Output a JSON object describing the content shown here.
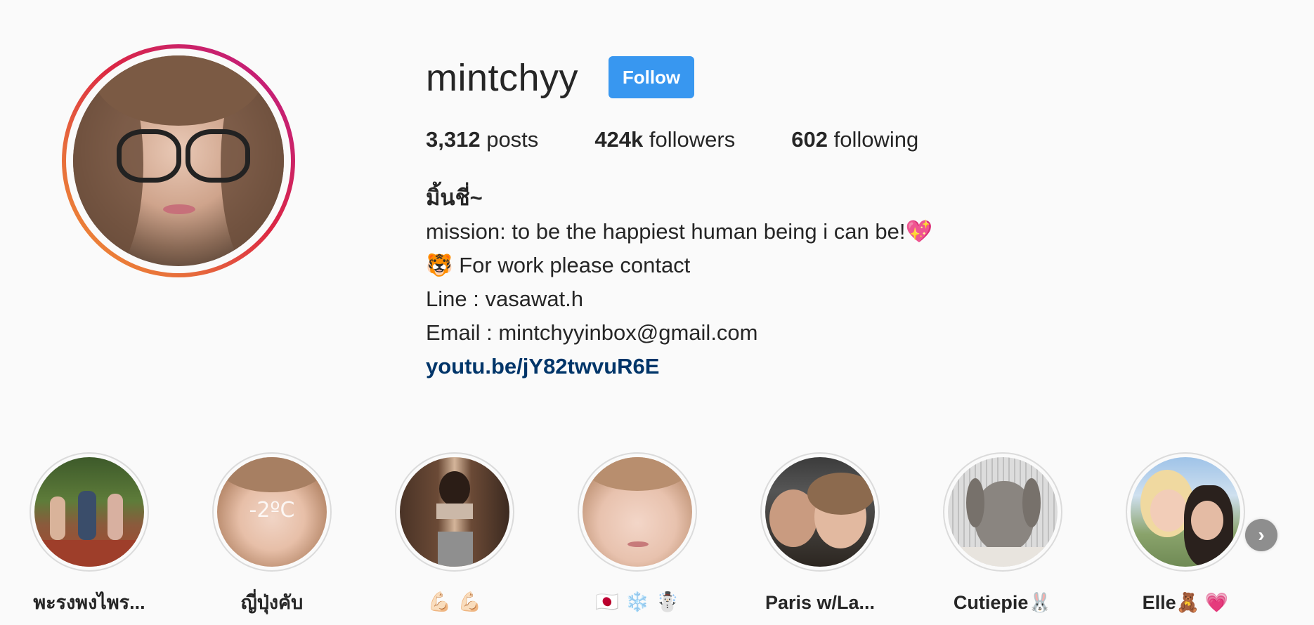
{
  "profile": {
    "username": "mintchyy",
    "follow_label": "Follow",
    "stats": {
      "posts_count": "3,312",
      "posts_label": "posts",
      "followers_count": "424k",
      "followers_label": "followers",
      "following_count": "602",
      "following_label": "following"
    },
    "bio": {
      "full_name": "มิ้นชี่~",
      "line1": "mission: to be the happiest human being i can be!💖",
      "line2": "🐯 For work please contact",
      "line3": "Line : vasawat.h",
      "line4": "Email : mintchyyinbox@gmail.com",
      "link": "youtu.be/jY82twvuR6E"
    }
  },
  "highlights": [
    {
      "label": "พะรงพงไพร...",
      "icon": "photo-group-sitting"
    },
    {
      "label": "ญี่ปุ่งคับ",
      "icon": "photo-selfie",
      "overlay_text": "-2ºC"
    },
    {
      "label": "💪🏻 💪🏻",
      "icon": "photo-mirror-selfie"
    },
    {
      "label": "🇯🇵 ❄️ ☃️",
      "icon": "photo-closeup"
    },
    {
      "label": "Paris w/La...",
      "icon": "photo-two-friends"
    },
    {
      "label": "Cutiepie🐰",
      "icon": "photo-bunny"
    },
    {
      "label": "Elle🧸 💗",
      "icon": "photo-friends"
    }
  ],
  "next_icon": "chevron-right-icon",
  "colors": {
    "follow": "#3897f0",
    "link": "#003569",
    "background": "#fafafa"
  }
}
